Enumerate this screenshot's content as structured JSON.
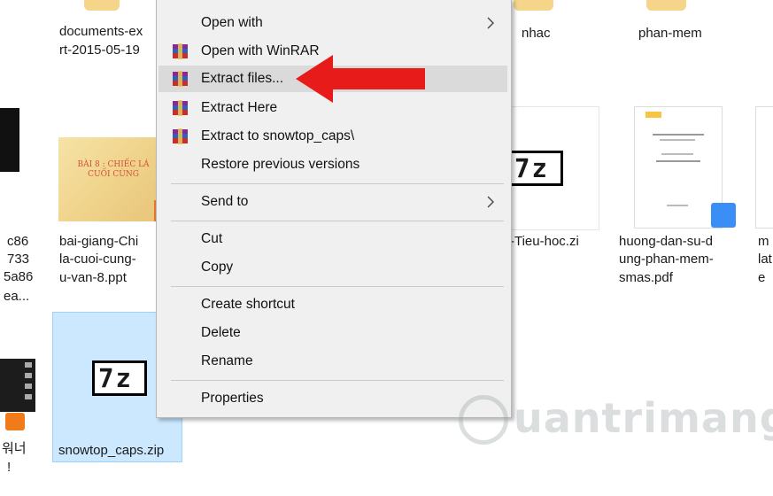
{
  "files": {
    "top_left": [
      "documents-ex",
      "rt-2015-05-19"
    ],
    "nhac": "nhac",
    "phan_mem": "phan-mem",
    "left_edge": [
      "c86",
      "733",
      "5a86",
      "ea..."
    ],
    "bai_giang": [
      "bai-giang-Chi",
      "la-cuoi-cung-",
      "u-van-8.ppt"
    ],
    "bai_thumb_title": "BÀI 8 : CHIẾC LÁ CUỐI CÙNG",
    "tieu_hoc": "-Tieu-hoc.zi",
    "huong_dan": [
      "huong-dan-su-d",
      "ung-phan-mem-",
      "smas.pdf"
    ],
    "right_edge": [
      "m",
      "lat",
      "e"
    ],
    "video_label": [
      "워너",
      "!"
    ],
    "selected": "snowtop_caps.zip",
    "zip_icon_text": "7z"
  },
  "context_menu": {
    "open_with": "Open with",
    "open_with_winrar": "Open with WinRAR",
    "extract_files": "Extract files...",
    "extract_here": "Extract Here",
    "extract_to": "Extract to snowtop_caps\\",
    "restore": "Restore previous versions",
    "send_to": "Send to",
    "cut": "Cut",
    "copy": "Copy",
    "create_shortcut": "Create shortcut",
    "delete": "Delete",
    "rename": "Rename",
    "properties": "Properties"
  },
  "watermark": "uantrimang",
  "colors": {
    "menu_bg": "#f0f0f0",
    "highlight": "#dadada",
    "selection": "#cce8ff",
    "arrow": "#e81b1b"
  }
}
